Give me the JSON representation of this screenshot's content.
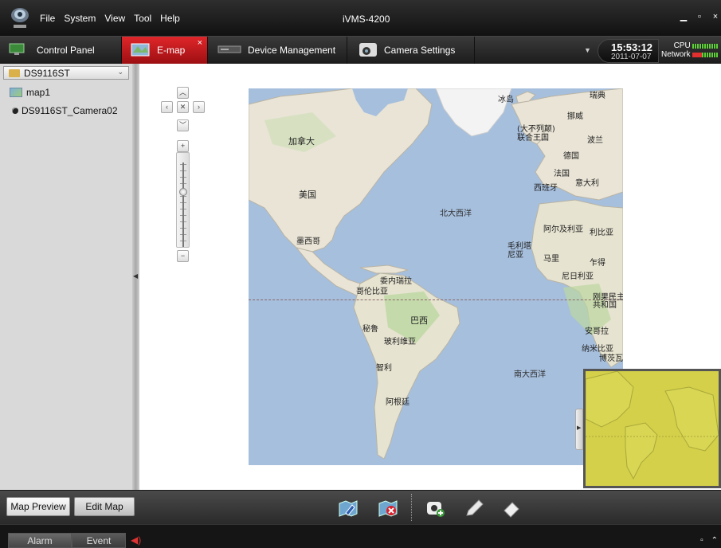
{
  "window": {
    "title": "iVMS-4200",
    "menu": [
      "File",
      "System",
      "View",
      "Tool",
      "Help"
    ],
    "controls": [
      "minimize-icon",
      "maximize-icon",
      "close-icon"
    ]
  },
  "tabs": [
    {
      "label": "Control Panel",
      "icon": "control-panel-icon",
      "active": false
    },
    {
      "label": "E-map",
      "icon": "emap-icon",
      "active": true,
      "close": "×"
    },
    {
      "label": "Device Management",
      "icon": "device-icon",
      "active": false
    },
    {
      "label": "Camera Settings",
      "icon": "camera-settings-icon",
      "active": false
    }
  ],
  "clock": {
    "time": "15:53:12",
    "date": "2011-07-07"
  },
  "perf": {
    "cpu_label": "CPU",
    "network_label": "Network"
  },
  "sidebar": {
    "device_select": "DS9116ST",
    "items": [
      {
        "label": "map1",
        "icon": "map-icon"
      },
      {
        "label": "DS9116ST_Camera02",
        "icon": "camera-icon"
      }
    ]
  },
  "map": {
    "labels": {
      "iceland": "冰岛",
      "sweden": "瑞典",
      "norway": "挪威",
      "uk": "(大不列颠)\n联合王国",
      "poland": "波兰",
      "canada": "加拿大",
      "germany": "德国",
      "france": "法国",
      "spain": "西班牙",
      "italy": "意大利",
      "usa": "美国",
      "north_atlantic": "北大西洋",
      "algeria": "阿尔及利亚",
      "libya": "利比亚",
      "mexico": "墨西哥",
      "mauritania": "毛利塔\n尼亚",
      "mali": "马里",
      "chad": "乍得",
      "nigeria": "尼日利亚",
      "venezuela": "委内瑞拉",
      "colombia": "哥伦比亚",
      "drc": "刚果民主\n共和国",
      "brazil": "巴西",
      "peru": "秘鲁",
      "bolivia": "玻利维亚",
      "angola": "安哥拉",
      "namibia": "纳米比亚",
      "botswana": "博茨瓦纳",
      "chile": "智利",
      "south_atlantic": "南大西洋",
      "argentina": "阿根廷"
    }
  },
  "bottom": {
    "map_preview": "Map Preview",
    "edit_map": "Edit Map",
    "tools": [
      "edit-map-icon",
      "delete-map-icon",
      "add-camera-icon",
      "pencil-icon",
      "eraser-icon"
    ]
  },
  "status": {
    "alarm": "Alarm",
    "event": "Event"
  }
}
